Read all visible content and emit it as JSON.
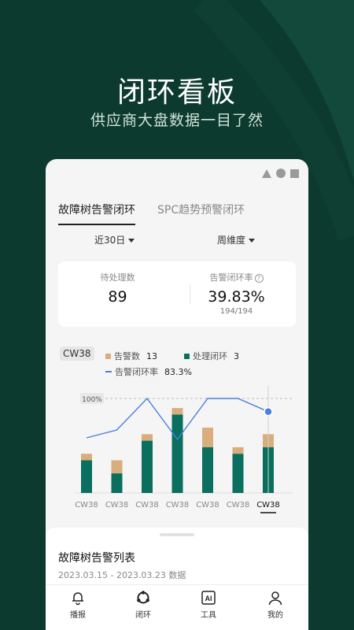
{
  "hero": {
    "title": "闭环看板",
    "subtitle": "供应商大盘数据一目了然"
  },
  "tabs": [
    {
      "label": "故障树告警闭环",
      "active": true
    },
    {
      "label": "SPC趋势预警闭环",
      "active": false
    }
  ],
  "filters": {
    "range": "近30日",
    "dimension": "周维度"
  },
  "stats": {
    "pending_label": "待处理数",
    "pending_value": "89",
    "rate_label": "告警闭环率",
    "rate_value": "39.83%",
    "rate_sub": "194/194"
  },
  "legend": {
    "week": "CW38",
    "alarm_label": "告警数",
    "alarm_value": "13",
    "closed_label": "处理闭环",
    "closed_value": "3",
    "rate_label": "告警闭环率",
    "rate_value": "83.3%"
  },
  "colors": {
    "alarm": "#d9ad7c",
    "closed": "#0a6f5e",
    "rate": "#4a7fe0",
    "background": "#0d3a2e"
  },
  "chart_data": {
    "type": "bar",
    "categories": [
      "CW38",
      "CW38",
      "CW38",
      "CW38",
      "CW38",
      "CW38",
      "CW38"
    ],
    "series": [
      {
        "name": "告警数",
        "values": [
          6,
          5,
          9,
          13,
          10,
          7,
          9
        ]
      },
      {
        "name": "处理闭环",
        "values": [
          5,
          3,
          8,
          12,
          7,
          6,
          7
        ]
      },
      {
        "name": "告警闭环率",
        "values": [
          50,
          60,
          100,
          48,
          100,
          100,
          83.3
        ]
      }
    ],
    "reference_line": "100%",
    "selected_index": 6
  },
  "sheet": {
    "title": "故障树告警列表",
    "subtitle": "2023.03.15 - 2023.03.23 数据"
  },
  "nav": [
    {
      "label": "播报",
      "icon": "bell-icon"
    },
    {
      "label": "闭环",
      "icon": "loop-icon"
    },
    {
      "label": "工具",
      "icon": "ai-icon",
      "icon_text": "AI"
    },
    {
      "label": "我的",
      "icon": "user-icon"
    }
  ]
}
